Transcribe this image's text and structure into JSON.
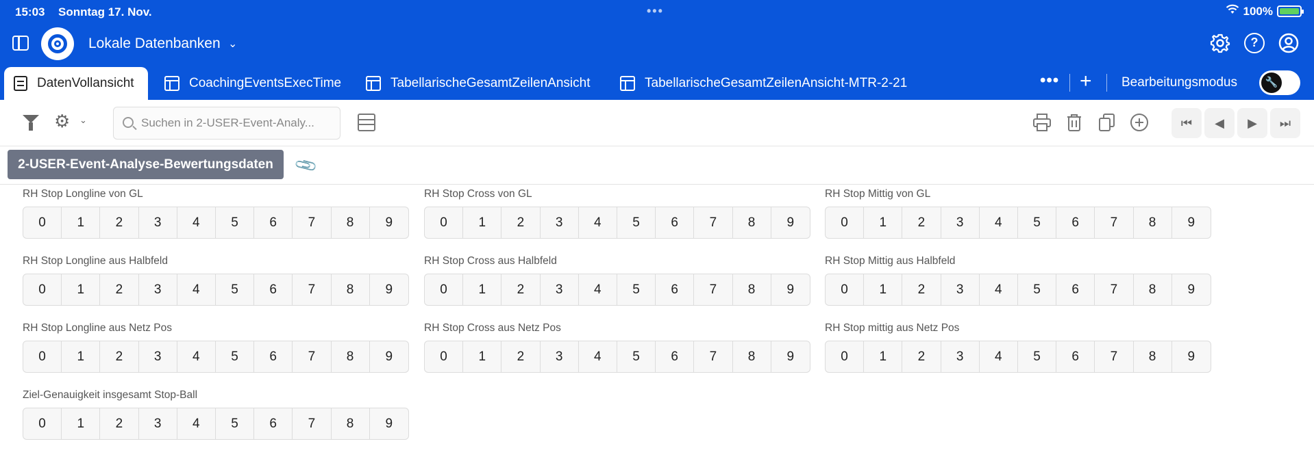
{
  "status_bar": {
    "time": "15:03",
    "date": "Sonntag 17. Nov.",
    "battery": "100%"
  },
  "app_bar": {
    "title": "Lokale Datenbanken"
  },
  "tabs": [
    {
      "label": "DatenVollansicht",
      "active": true
    },
    {
      "label": "CoachingEventsExecTime",
      "active": false
    },
    {
      "label": "TabellarischeGesamtZeilenAnsicht",
      "active": false
    },
    {
      "label": "TabellarischeGesamtZeilenAnsicht-MTR-2-21",
      "active": false
    }
  ],
  "tab_tools": {
    "edit_mode_label": "Bearbeitungsmodus",
    "edit_mode_on": false
  },
  "toolbar": {
    "search_placeholder": "Suchen in 2-USER-Event-Analy..."
  },
  "section": {
    "tab_label": "2-USER-Event-Analyse-Bewertungsdaten"
  },
  "scale_values": [
    "0",
    "1",
    "2",
    "3",
    "4",
    "5",
    "6",
    "7",
    "8",
    "9"
  ],
  "groups": [
    {
      "label": "RH Stop Longline von GL"
    },
    {
      "label": "RH Stop Cross von GL"
    },
    {
      "label": "RH Stop Mittig von GL"
    },
    {
      "label": "RH Stop Longline aus Halbfeld"
    },
    {
      "label": "RH Stop Cross aus Halbfeld"
    },
    {
      "label": "RH Stop Mittig aus Halbfeld"
    },
    {
      "label": "RH Stop Longline aus Netz Pos"
    },
    {
      "label": "RH Stop Cross aus Netz Pos"
    },
    {
      "label": "RH Stop mittig aus Netz Pos"
    },
    {
      "label": "Ziel-Genauigkeit insgesamt Stop-Ball"
    }
  ],
  "colors": {
    "brand_blue": "#0a56db",
    "section_tab": "#6d7485",
    "battery_green": "#5fd15f"
  },
  "icons": [
    "sidebar-toggle-icon",
    "app-logo-icon",
    "chevron-down-icon",
    "gear-icon",
    "help-icon",
    "account-icon",
    "document-icon",
    "table-icon",
    "more-icon",
    "plus-icon",
    "wrench-icon",
    "filter-icon",
    "search-icon",
    "layout-icon",
    "print-icon",
    "trash-icon",
    "copy-icon",
    "add-circle-icon",
    "first-page-icon",
    "prev-icon",
    "next-icon",
    "last-page-icon",
    "paperclip-icon",
    "wifi-icon",
    "battery-icon"
  ]
}
